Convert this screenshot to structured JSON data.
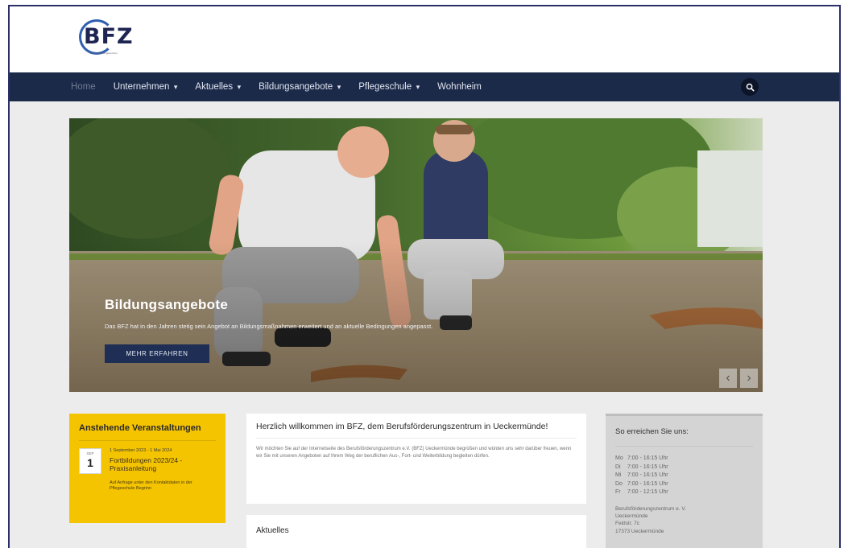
{
  "header": {
    "logo_text": "BFZ",
    "logo_subtext": "Berufsförderungszentrum"
  },
  "nav": {
    "items": [
      {
        "label": "Home",
        "has_dropdown": false
      },
      {
        "label": "Unternehmen",
        "has_dropdown": true
      },
      {
        "label": "Aktuelles",
        "has_dropdown": true
      },
      {
        "label": "Bildungsangebote",
        "has_dropdown": true
      },
      {
        "label": "Pflegeschule",
        "has_dropdown": true
      },
      {
        "label": "Wohnheim",
        "has_dropdown": false
      }
    ],
    "search_icon": "search-icon"
  },
  "hero": {
    "title": "Bildungsangebote",
    "text": "Das BFZ hat in den Jahren stetig sein Angebot an Bildungsmaßnahmen erweitert und an aktuelle Bedingungen angepasst.",
    "button_label": "MEHR ERFAHREN",
    "prev_icon": "chevron-left-icon",
    "next_icon": "chevron-right-icon"
  },
  "events": {
    "title": "Anstehende Veranstaltungen",
    "items": [
      {
        "month": "SEP",
        "day": "1",
        "range": "1 September 2023 - 1 Mai 2024",
        "name": "Fortbildungen 2023/24 - Praxisanleitung",
        "description": "Auf Anfrage unter den Kontaktdaten in der Pflegeschule Begrinn"
      }
    ]
  },
  "welcome": {
    "title": "Herzlich willkommen im BFZ, dem Berufsförderungszentrum in Ueckermünde!",
    "text": "Wir möchten Sie auf der Internetseite des Berufsförderungszentrum e.V. (BFZ) Ueckermünde begrüßen und würden uns sehr darüber freuen, wenn wir Sie mit unseren Angeboten auf Ihrem Weg der beruflichen Aus-, Fort- und Weiterbildung begleiten dürfen."
  },
  "news": {
    "title": "Aktuelles"
  },
  "contact": {
    "title": "So erreichen Sie uns:",
    "hours": [
      {
        "day": "Mo",
        "time": "7:00 - 16:15 Uhr"
      },
      {
        "day": "Di",
        "time": "7:00 - 16:15 Uhr"
      },
      {
        "day": "Mi",
        "time": "7:00 - 16:15 Uhr"
      },
      {
        "day": "Do",
        "time": "7:00 - 16:15 Uhr"
      },
      {
        "day": "Fr",
        "time": "7:00 - 12:15 Uhr"
      }
    ],
    "address": [
      "Berufsförderungszentrum e. V.",
      "Ueckermünde",
      "Feldstr. 7c",
      "17373 Ueckermünde"
    ]
  },
  "colors": {
    "nav_bg": "#1c2a4a",
    "accent_yellow": "#f5c400",
    "button_blue": "#1e2e55",
    "page_bg": "#ececec",
    "frame_border": "#2b3069"
  }
}
